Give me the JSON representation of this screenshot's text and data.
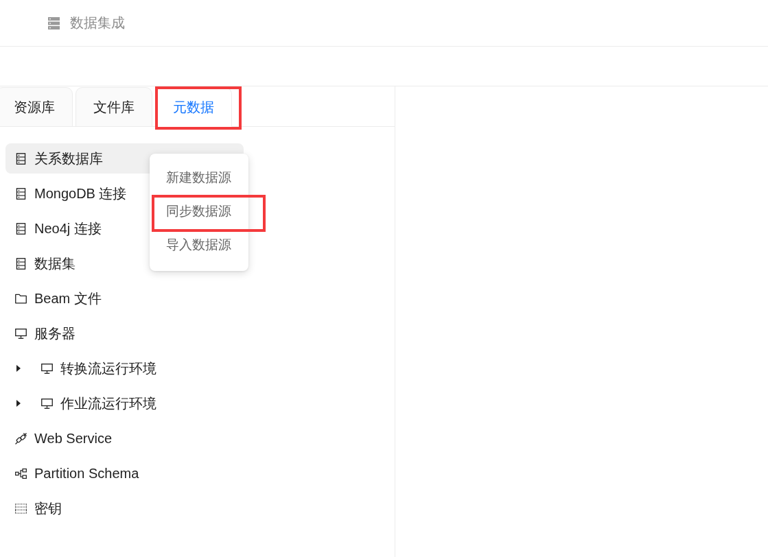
{
  "header": {
    "title": "数据集成"
  },
  "tabs": [
    {
      "label": "资源库",
      "selected": false,
      "highlighted": false
    },
    {
      "label": "文件库",
      "selected": false,
      "highlighted": false
    },
    {
      "label": "元数据",
      "selected": true,
      "highlighted": true
    }
  ],
  "tree": {
    "items": [
      {
        "kind": "database",
        "label": "关系数据库",
        "selected": true
      },
      {
        "kind": "database",
        "label": "MongoDB 连接",
        "selected": false
      },
      {
        "kind": "database",
        "label": "Neo4j 连接",
        "selected": false
      },
      {
        "kind": "database",
        "label": "数据集",
        "selected": false
      },
      {
        "kind": "folder",
        "label": "Beam 文件",
        "selected": false
      },
      {
        "kind": "monitor",
        "label": "服务器",
        "selected": false
      },
      {
        "kind": "monitor",
        "label": "转换流运行环境",
        "selected": false,
        "expanded": false
      },
      {
        "kind": "monitor",
        "label": "作业流运行环境",
        "selected": false,
        "expanded": false
      },
      {
        "kind": "connector",
        "label": "Web Service",
        "selected": false
      },
      {
        "kind": "hierarchy",
        "label": "Partition Schema",
        "selected": false
      },
      {
        "kind": "dotted-grid",
        "label": "密钥",
        "selected": false
      }
    ]
  },
  "context_menu": {
    "items": [
      {
        "label": "新建数据源",
        "highlighted": false
      },
      {
        "label": "同步数据源",
        "highlighted": true
      },
      {
        "label": "导入数据源",
        "highlighted": false
      }
    ]
  }
}
